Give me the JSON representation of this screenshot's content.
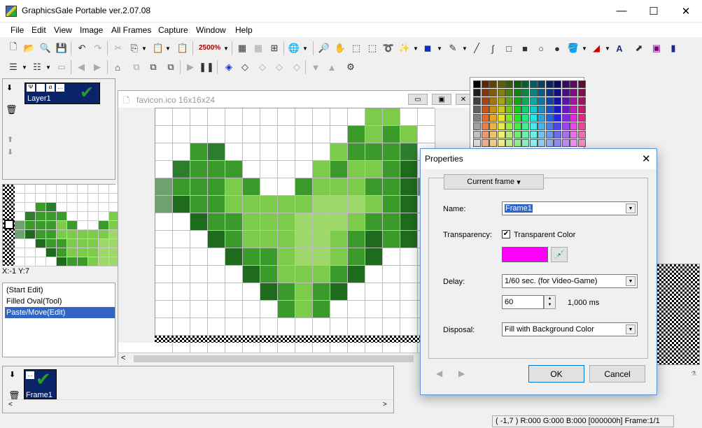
{
  "window": {
    "title": "GraphicsGale Portable ver.2.07.08",
    "minimize": "—",
    "maximize": "☐",
    "close": "✕"
  },
  "menu": [
    "File",
    "Edit",
    "View",
    "Image",
    "All Frames",
    "Capture",
    "Window",
    "Help"
  ],
  "toolbar": {
    "zoom": "2500%"
  },
  "layers": {
    "name": "Layer1"
  },
  "preview": {
    "coords": "X:-1 Y:7"
  },
  "history": [
    "(Start Edit)",
    "Filled Oval(Tool)",
    "Paste/Move(Edit)"
  ],
  "frames": {
    "name": "Frame1"
  },
  "document": {
    "title": "favicon.ico 16x16x24"
  },
  "dialog": {
    "title": "Properties",
    "frame_button": "Current frame",
    "name_label": "Name:",
    "name_value": "Frame1",
    "transparency_label": "Transparency:",
    "transparent_color_label": "Transparent Color",
    "transparent_color": "#ff00ff",
    "delay_label": "Delay:",
    "delay_option": "1/60 sec. (for Video-Game)",
    "delay_value": "60",
    "delay_ms": "1,000 ms",
    "disposal_label": "Disposal:",
    "disposal_value": "Fill with Background Color",
    "ok": "OK",
    "cancel": "Cancel"
  },
  "status": {
    "text": "( -1,7 ) R:000 G:000 B:000  [000000h]  Frame:1/1"
  },
  "colors": {
    "dark": "#1e6b1e",
    "mid": "#3a9a2a",
    "light": "#7ccb4a",
    "pale": "#9fd86a"
  }
}
